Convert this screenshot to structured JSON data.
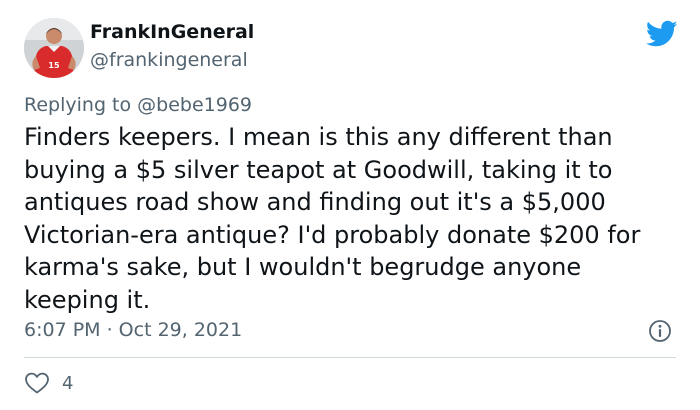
{
  "tweet": {
    "author_name": "FrankInGeneral",
    "author_handle": "@frankingeneral",
    "replying_to_label": "Replying to",
    "replying_to_handle": "@bebe1969",
    "body_lines": [
      "Finders keepers. I mean is this any different than",
      "buying a $5 silver teapot at Goodwill, taking it to",
      "antiques road show and finding out it's a $5,000",
      "Victorian-era antique? I'd probably donate $200 for",
      "karma's sake, but I wouldn't begrudge anyone",
      "keeping it."
    ],
    "timestamp": "6:07 PM · Oct 29, 2021",
    "like_count": "4",
    "avatar_jersey_number": "15"
  },
  "icons": {
    "brand": "twitter-bird-icon",
    "info": "info-icon",
    "like": "heart-icon"
  },
  "colors": {
    "twitter_blue": "#1d9bf0",
    "text_primary": "#0f1419",
    "text_secondary": "#536471",
    "divider": "#cfd9de"
  }
}
